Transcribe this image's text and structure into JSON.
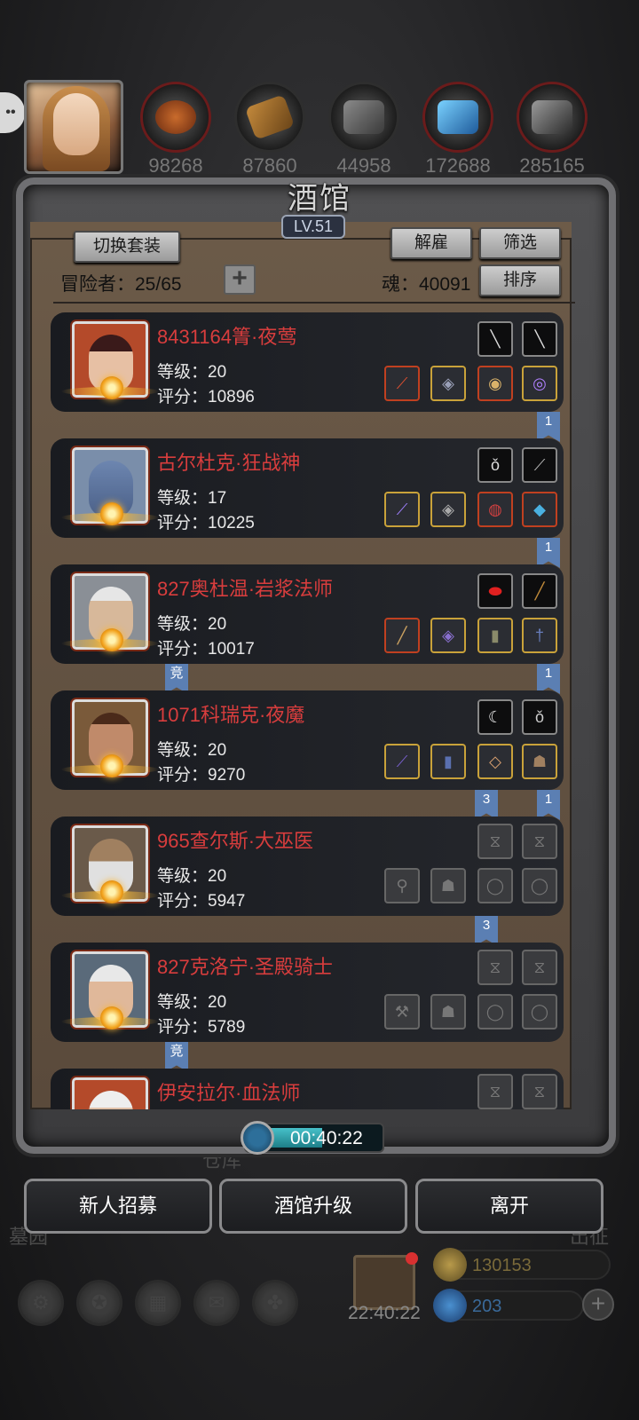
{
  "header": {
    "resources": [
      {
        "value": "98268",
        "icon": "bread-icon"
      },
      {
        "value": "87860",
        "icon": "wood-icon"
      },
      {
        "value": "44958",
        "icon": "stone-icon"
      },
      {
        "value": "172688",
        "icon": "crystal-icon"
      },
      {
        "value": "285165",
        "icon": "iron-icon"
      }
    ]
  },
  "tavern": {
    "title": "酒馆",
    "level": "LV.51",
    "switch_outfit": "切换套装",
    "dismiss": "解雇",
    "filter": "筛选",
    "sort": "排序",
    "adventurers_label": "冒险者：25/65",
    "soul_label": "魂：40091"
  },
  "heroes": [
    {
      "name": "8431164箐·夜莺",
      "level": "等级：20",
      "score": "评分：10896",
      "left_tag": "",
      "tags": [
        "",
        "1"
      ]
    },
    {
      "name": "古尔杜克·狂战神",
      "level": "等级：17",
      "score": "评分：10225",
      "left_tag": "",
      "tags": [
        "",
        "1"
      ]
    },
    {
      "name": "827奥杜温·岩浆法师",
      "level": "等级：20",
      "score": "评分：10017",
      "left_tag": "竞",
      "tags": [
        "",
        "1"
      ]
    },
    {
      "name": "1071科瑞克·夜魔",
      "level": "等级：20",
      "score": "评分：9270",
      "left_tag": "",
      "tags": [
        "3",
        "1"
      ]
    },
    {
      "name": "965查尔斯·大巫医",
      "level": "等级：20",
      "score": "评分：5947",
      "left_tag": "",
      "tags": [
        "3",
        ""
      ]
    },
    {
      "name": "827克洛宁·圣殿骑士",
      "level": "等级：20",
      "score": "评分：5789",
      "left_tag": "竞",
      "tags": [
        "",
        ""
      ]
    },
    {
      "name": "伊安拉尔·血法师",
      "level": "",
      "score": "",
      "left_tag": "",
      "tags": [
        "",
        ""
      ]
    }
  ],
  "timer": "00:40:22",
  "actions": {
    "recruit": "新人招募",
    "upgrade": "酒馆升级",
    "leave": "离开"
  },
  "background": {
    "left_label": "墓园",
    "center_label": "仓库",
    "right_label": "出征"
  },
  "footer": {
    "gift_timer": "22:40:22",
    "gold": "130153",
    "gems": "203"
  }
}
